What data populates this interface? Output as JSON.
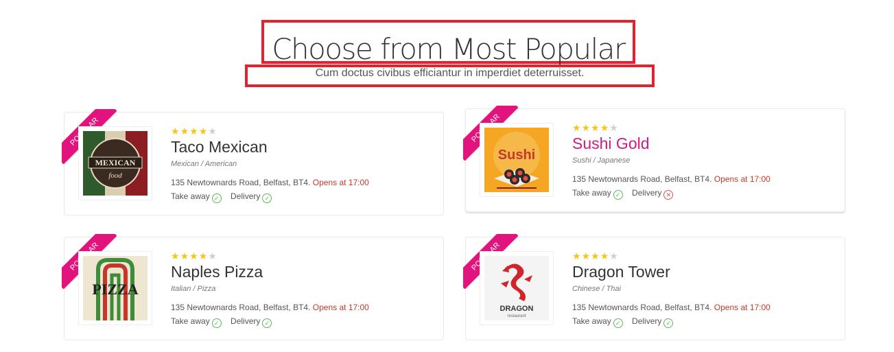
{
  "header": {
    "title": "Choose from Most Popular",
    "subtitle": "Cum doctus civibus efficiantur in imperdiet deterruisset."
  },
  "colors": {
    "accent": "#e2137d",
    "highlight_box": "#e0232e",
    "opens": "#c0392b"
  },
  "restaurants": [
    {
      "badge": "Popular",
      "rating": 4,
      "rating_max": 5,
      "name": "Taco Mexican",
      "cuisine": "Mexican / American",
      "address": "135 Newtownards Road, Belfast, BT4.",
      "opens": "Opens at 17:00",
      "takeaway_label": "Take away",
      "takeaway": true,
      "delivery_label": "Delivery",
      "delivery": true,
      "logo_text": "MEXICAN",
      "logo_subtext": "food"
    },
    {
      "badge": "Popular",
      "rating": 4,
      "rating_max": 5,
      "name": "Sushi Gold",
      "cuisine": "Sushi / Japanese",
      "address": "135 Newtownards Road, Belfast, BT4.",
      "opens": "Opens at 17:00",
      "takeaway_label": "Take away",
      "takeaway": true,
      "delivery_label": "Delivery",
      "delivery": false,
      "logo_text": "Sushi"
    },
    {
      "badge": "Popular",
      "rating": 4,
      "rating_max": 5,
      "name": "Naples Pizza",
      "cuisine": "Italian / Pizza",
      "address": "135 Newtownards Road, Belfast, BT4.",
      "opens": "Opens at 17:00",
      "takeaway_label": "Take away",
      "takeaway": true,
      "delivery_label": "Delivery",
      "delivery": true,
      "logo_text": "PIZZA"
    },
    {
      "badge": "Popular",
      "rating": 4,
      "rating_max": 5,
      "name": "Dragon Tower",
      "cuisine": "Chinese / Thai",
      "address": "135 Newtownards Road, Belfast, BT4.",
      "opens": "Opens at 17:00",
      "takeaway_label": "Take away",
      "takeaway": true,
      "delivery_label": "Delivery",
      "delivery": true,
      "logo_text": "DRAGON",
      "logo_subtext": "restaurant"
    }
  ]
}
